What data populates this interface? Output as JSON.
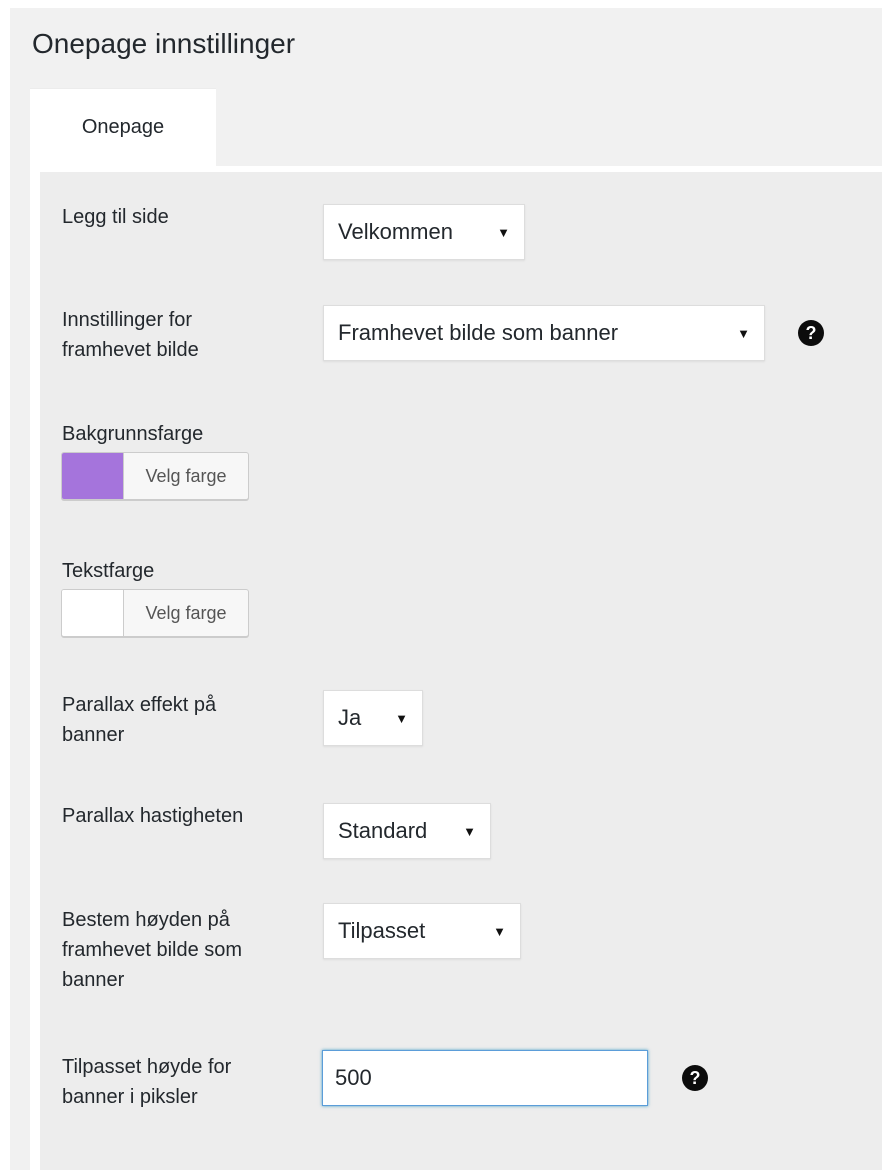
{
  "page": {
    "title": "Onepage innstillinger"
  },
  "tabs": [
    {
      "label": "Onepage",
      "active": true
    }
  ],
  "fields": {
    "add_page": {
      "label": "Legg til side",
      "value": "Velkommen"
    },
    "featured_image_settings": {
      "label_line1": "Innstillinger for",
      "label_line2": "framhevet bilde",
      "value": "Framhevet bilde som banner",
      "help_icon": "question-circle-icon",
      "help_glyph": "?"
    },
    "background_color": {
      "label": "Bakgrunnsfarge",
      "button_label": "Velg farge",
      "color": "#a574dc"
    },
    "text_color": {
      "label": "Tekstfarge",
      "button_label": "Velg farge",
      "color": "#ffffff"
    },
    "parallax_effect": {
      "label_line1": "Parallax effekt på",
      "label_line2": "banner",
      "value": "Ja"
    },
    "parallax_speed": {
      "label": "Parallax hastigheten",
      "value": "Standard"
    },
    "banner_height_mode": {
      "label_line1": "Bestem høyden på",
      "label_line2": "framhevet bilde som",
      "label_line3": "banner",
      "value": "Tilpasset"
    },
    "custom_height": {
      "label_line1": "Tilpasset høyde for",
      "label_line2": "banner i piksler",
      "value": "500",
      "help_icon": "question-circle-icon",
      "help_glyph": "?"
    }
  },
  "icons": {
    "dropdown_arrow": "▼"
  }
}
